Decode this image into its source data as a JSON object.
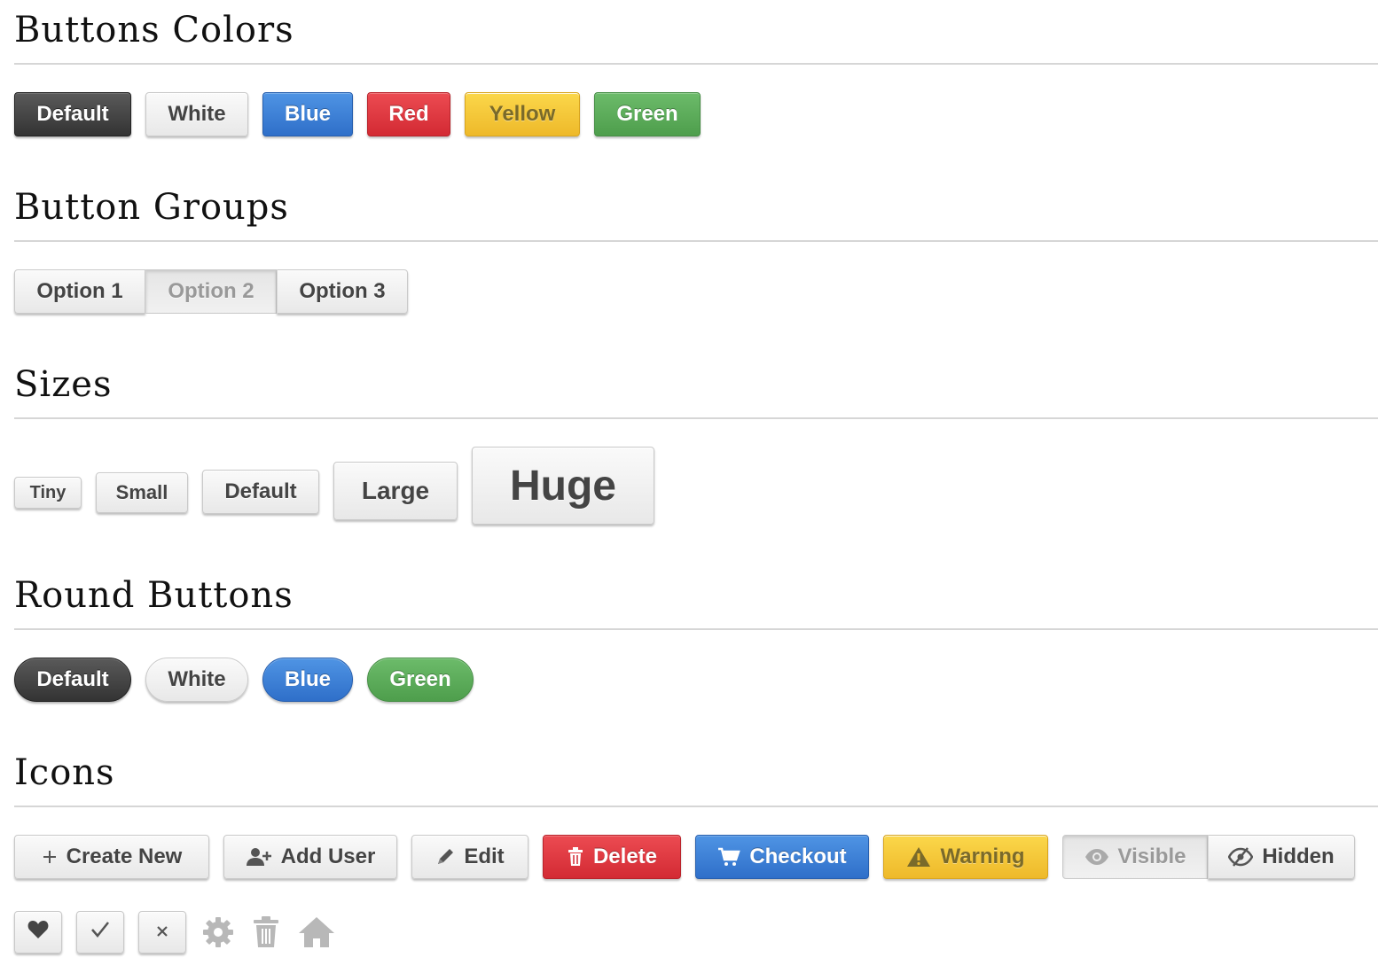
{
  "sections": {
    "colors": {
      "title": "Buttons Colors",
      "buttons": [
        "Default",
        "White",
        "Blue",
        "Red",
        "Yellow",
        "Green"
      ]
    },
    "groups": {
      "title": "Button Groups",
      "options": [
        "Option 1",
        "Option 2",
        "Option 3"
      ],
      "active_option": "Option 2"
    },
    "sizes": {
      "title": "Sizes",
      "buttons": [
        "Tiny",
        "Small",
        "Default",
        "Large",
        "Huge"
      ]
    },
    "round": {
      "title": "Round Buttons",
      "buttons": [
        "Default",
        "White",
        "Blue",
        "Green"
      ]
    },
    "icons": {
      "title": "Icons",
      "buttons": [
        {
          "label": "Create New",
          "icon": "plus-icon"
        },
        {
          "label": "Add User",
          "icon": "add-user-icon"
        },
        {
          "label": "Edit",
          "icon": "pencil-icon"
        },
        {
          "label": "Delete",
          "icon": "trash-icon"
        },
        {
          "label": "Checkout",
          "icon": "cart-icon"
        },
        {
          "label": "Warning",
          "icon": "warning-icon"
        }
      ],
      "toggle": [
        {
          "label": "Visible",
          "icon": "eye-icon"
        },
        {
          "label": "Hidden",
          "icon": "eye-slash-icon"
        }
      ],
      "icon_buttons": [
        "heart-icon",
        "check-icon",
        "close-icon"
      ],
      "bare_icons": [
        "gear-icon",
        "trash-icon",
        "home-icon"
      ]
    }
  },
  "colors": {
    "default": "#333333",
    "blue": "#2f6fc9",
    "red": "#d32a33",
    "yellow": "#eeb92a",
    "green": "#4e9e4c",
    "rule": "#d6d6d6"
  }
}
